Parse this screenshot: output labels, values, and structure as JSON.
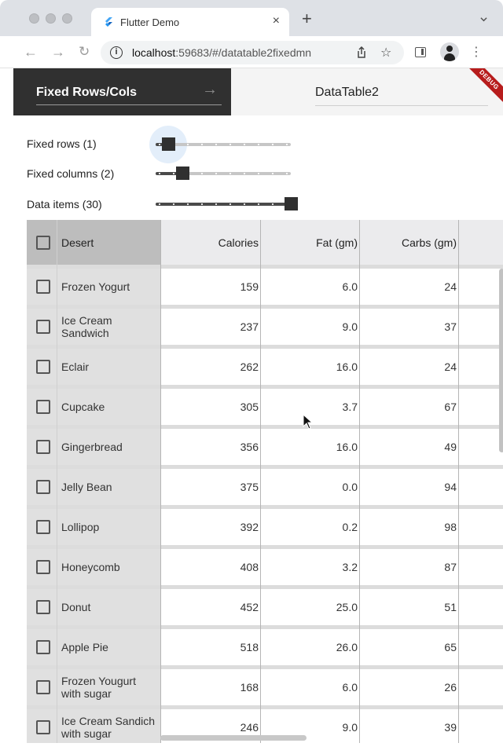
{
  "browser": {
    "tab_title": "Flutter Demo",
    "tab_close": "×",
    "new_tab": "+",
    "url_host": "localhost",
    "url_rest": ":59683/#/datatable2fixedmn",
    "info": "i"
  },
  "app": {
    "nav_left_label": "Fixed Rows/Cols",
    "nav_right_label": "DataTable2",
    "debug_banner": "DEBUG",
    "controls": {
      "fixed_rows_label": "Fixed rows (1)",
      "fixed_rows_value": 1,
      "fixed_columns_label": "Fixed columns (2)",
      "fixed_columns_value": 2,
      "data_items_label": "Data items (30)",
      "data_items_value": 30
    },
    "table": {
      "headers": [
        "Desert",
        "Calories",
        "Fat (gm)",
        "Carbs (gm)"
      ],
      "rows": [
        {
          "name": "Frozen Yogurt",
          "calories": "159",
          "fat": "6.0",
          "carbs": "24"
        },
        {
          "name": "Ice Cream\nSandwich",
          "calories": "237",
          "fat": "9.0",
          "carbs": "37"
        },
        {
          "name": "Eclair",
          "calories": "262",
          "fat": "16.0",
          "carbs": "24"
        },
        {
          "name": "Cupcake",
          "calories": "305",
          "fat": "3.7",
          "carbs": "67"
        },
        {
          "name": "Gingerbread",
          "calories": "356",
          "fat": "16.0",
          "carbs": "49"
        },
        {
          "name": "Jelly Bean",
          "calories": "375",
          "fat": "0.0",
          "carbs": "94"
        },
        {
          "name": "Lollipop",
          "calories": "392",
          "fat": "0.2",
          "carbs": "98"
        },
        {
          "name": "Honeycomb",
          "calories": "408",
          "fat": "3.2",
          "carbs": "87"
        },
        {
          "name": "Donut",
          "calories": "452",
          "fat": "25.0",
          "carbs": "51"
        },
        {
          "name": "Apple Pie",
          "calories": "518",
          "fat": "26.0",
          "carbs": "65"
        },
        {
          "name": "Frozen Yougurt\nwith sugar",
          "calories": "168",
          "fat": "6.0",
          "carbs": "26"
        },
        {
          "name": "Ice Cream Sandich\nwith sugar",
          "calories": "246",
          "fat": "9.0",
          "carbs": "39"
        }
      ]
    }
  },
  "colors": {
    "nav_dark": "#303030",
    "debug_red": "#b71c1c",
    "fixed_cell_bg": "#e0e0e0",
    "header_fixed_bg": "#bdbdbd",
    "header_bg": "#ebebed"
  }
}
